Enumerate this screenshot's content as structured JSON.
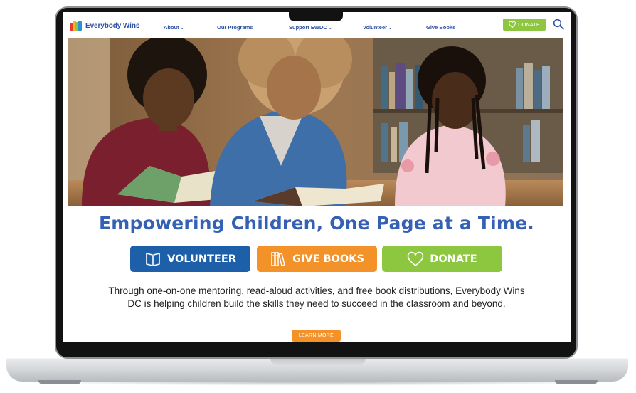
{
  "header": {
    "logo_text": "Everybody Wins",
    "nav": [
      {
        "label": "About",
        "has_dropdown": true
      },
      {
        "label": "Our Programs",
        "has_dropdown": false
      },
      {
        "label": "Support EWDC",
        "has_dropdown": true
      },
      {
        "label": "Volunteer",
        "has_dropdown": true
      },
      {
        "label": "Give Books",
        "has_dropdown": false
      }
    ],
    "donate_label": "DONATE"
  },
  "hero": {
    "headline": "Empowering Children, One Page at a Time."
  },
  "cta": {
    "volunteer_label": "VOLUNTEER",
    "give_books_label": "GIVE BOOKS",
    "donate_label": "DONATE"
  },
  "body": {
    "paragraph": "Through one-on-one mentoring, read-aloud activities, and free book distributions, Everybody Wins DC is helping children build the skills they need to succeed in the classroom and beyond.",
    "learn_more_label": "LEARN MORE"
  },
  "colors": {
    "brand_blue": "#2d4fa3",
    "headline_blue": "#3561b5",
    "volunteer_blue": "#1e5faa",
    "books_orange": "#f4922a",
    "donate_green": "#8dc63f"
  },
  "icons": [
    "logo-books-icon",
    "chevron-down-icon",
    "heart-icon",
    "search-icon",
    "open-book-icon",
    "books-icon"
  ]
}
